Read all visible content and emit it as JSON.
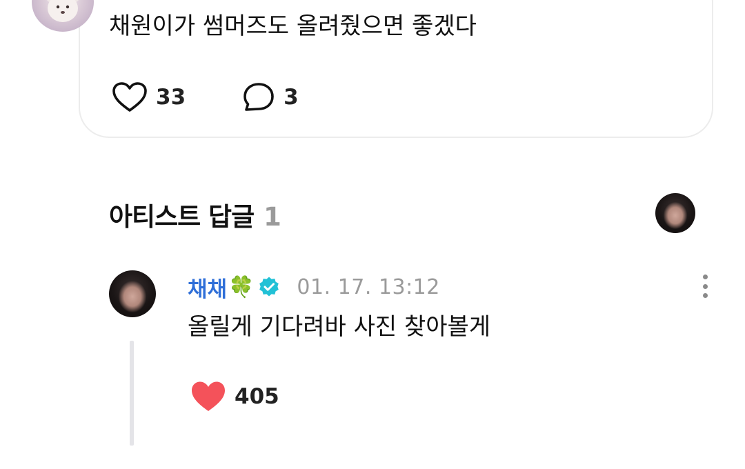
{
  "post": {
    "text": "채원이가 썸머즈도 올려줬으면 좋겠다",
    "like_count": "33",
    "comment_count": "3"
  },
  "artist_replies": {
    "title": "아티스트 답글",
    "count": "1"
  },
  "reply": {
    "author": "채채",
    "author_emoji": "🍀",
    "timestamp": "01. 17. 13:12",
    "text": "올릴게 기다려바 사진 찾아볼게",
    "like_count": "405"
  },
  "colors": {
    "author_name": "#2f6fd8",
    "verified_badge": "#22c1d6",
    "liked_heart": "#f4525a",
    "muted_text": "#9a9a9a"
  },
  "icons": {
    "post_like": "heart-outline-icon",
    "post_comment": "speech-bubble-icon",
    "verified": "verified-badge-icon",
    "more": "more-vertical-icon",
    "reply_like": "heart-filled-icon"
  }
}
